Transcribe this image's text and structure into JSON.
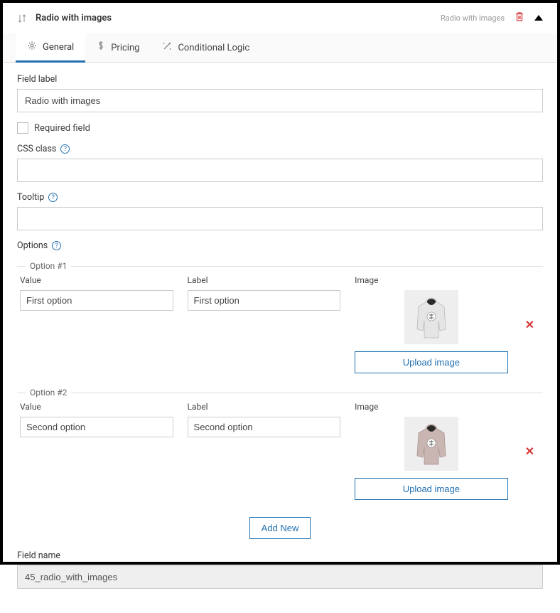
{
  "header": {
    "title": "Radio with images",
    "typeLabel": "Radio with images"
  },
  "tabs": {
    "general": "General",
    "pricing": "Pricing",
    "conditional": "Conditional Logic"
  },
  "labels": {
    "fieldLabel": "Field label",
    "requiredField": "Required field",
    "cssClass": "CSS class",
    "tooltip": "Tooltip",
    "options": "Options",
    "fieldName": "Field name",
    "value": "Value",
    "labelCol": "Label",
    "image": "Image",
    "uploadImage": "Upload image",
    "addNew": "Add New"
  },
  "fields": {
    "fieldLabelValue": "Radio with images",
    "cssClassValue": "",
    "tooltipValue": "",
    "fieldNameValue": "45_radio_with_images"
  },
  "options": [
    {
      "legend": "Option #1",
      "value": "First option",
      "label": "First option",
      "imageTint": "light"
    },
    {
      "legend": "Option #2",
      "value": "Second option",
      "label": "Second option",
      "imageTint": "pink"
    }
  ]
}
